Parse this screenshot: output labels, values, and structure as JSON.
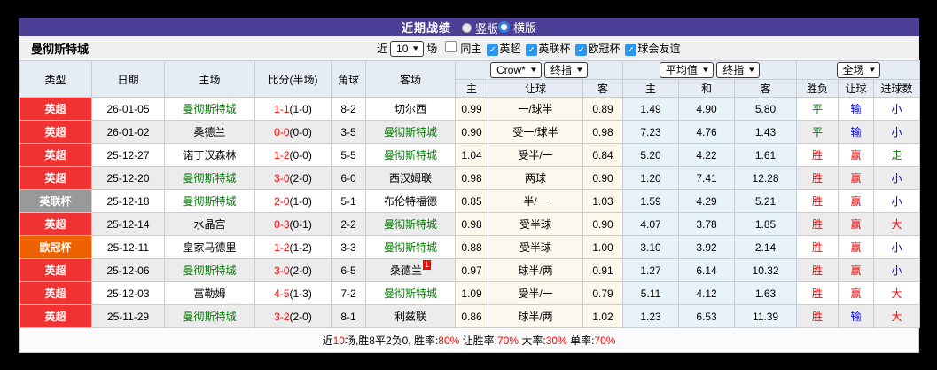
{
  "icons": {
    "select_caret": "▼",
    "checkbox_check": "✓"
  },
  "colors": {
    "title_bar": "#4c4096",
    "league_epl": "#ef3333",
    "league_eflcup": "#999999",
    "league_ucl": "#ee6101",
    "win_red": "#ff0000",
    "draw_green": "#008000",
    "lose_blue": "#0000f0"
  },
  "title_bar": {
    "title": "近期战绩",
    "radios": [
      {
        "label": "竖版",
        "checked": false
      },
      {
        "label": "横版",
        "checked": true
      }
    ]
  },
  "toolbar": {
    "team": "曼彻斯特城",
    "recent_prefix": "近",
    "recent_count": "10",
    "recent_suffix": "场",
    "filters": [
      {
        "label": "同主",
        "checked": false
      },
      {
        "label": "英超",
        "checked": true
      },
      {
        "label": "英联杯",
        "checked": true
      },
      {
        "label": "欧冠杯",
        "checked": true
      },
      {
        "label": "球会友谊",
        "checked": true
      }
    ]
  },
  "table": {
    "left_headers": [
      "类型",
      "日期",
      "主场",
      "比分(半场)",
      "角球",
      "客场"
    ],
    "selects": {
      "asian": [
        "Crow*",
        "终指"
      ],
      "europe": [
        "平均值",
        "终指"
      ],
      "result": [
        "全场"
      ]
    },
    "sub_headers": [
      "主",
      "让球",
      "客",
      "主",
      "和",
      "客",
      "胜负",
      "让球",
      "进球数"
    ],
    "rows": [
      {
        "type": "英超",
        "type_color": "#ef3333",
        "date": "26-01-05",
        "home": "曼彻斯特城",
        "home_highlight": true,
        "score": "1-1",
        "half": "(1-0)",
        "corner": "8-2",
        "away": "切尔西",
        "away_highlight": false,
        "away_card": "",
        "ah": [
          "0.99",
          "一/球半",
          "0.89"
        ],
        "eu": [
          "1.49",
          "4.90",
          "5.80"
        ],
        "result": {
          "text": "平",
          "color": "green"
        },
        "ah_result": {
          "text": "输",
          "color": "blue"
        },
        "goals": {
          "text": "小",
          "color": "blue"
        }
      },
      {
        "type": "英超",
        "type_color": "#ef3333",
        "date": "26-01-02",
        "home": "桑德兰",
        "home_highlight": false,
        "score": "0-0",
        "half": "(0-0)",
        "corner": "3-5",
        "away": "曼彻斯特城",
        "away_highlight": true,
        "away_card": "",
        "ah": [
          "0.90",
          "受一/球半",
          "0.98"
        ],
        "eu": [
          "7.23",
          "4.76",
          "1.43"
        ],
        "result": {
          "text": "平",
          "color": "green"
        },
        "ah_result": {
          "text": "输",
          "color": "blue"
        },
        "goals": {
          "text": "小",
          "color": "blue"
        }
      },
      {
        "type": "英超",
        "type_color": "#ef3333",
        "date": "25-12-27",
        "home": "诺丁汉森林",
        "home_highlight": false,
        "score": "1-2",
        "half": "(0-0)",
        "corner": "5-5",
        "away": "曼彻斯特城",
        "away_highlight": true,
        "away_card": "",
        "ah": [
          "1.04",
          "受半/一",
          "0.84"
        ],
        "eu": [
          "5.20",
          "4.22",
          "1.61"
        ],
        "result": {
          "text": "胜",
          "color": "red"
        },
        "ah_result": {
          "text": "赢",
          "color": "red"
        },
        "goals": {
          "text": "走",
          "color": "green"
        }
      },
      {
        "type": "英超",
        "type_color": "#ef3333",
        "date": "25-12-20",
        "home": "曼彻斯特城",
        "home_highlight": true,
        "score": "3-0",
        "half": "(2-0)",
        "corner": "6-0",
        "away": "西汉姆联",
        "away_highlight": false,
        "away_card": "",
        "ah": [
          "0.98",
          "两球",
          "0.90"
        ],
        "eu": [
          "1.20",
          "7.41",
          "12.28"
        ],
        "result": {
          "text": "胜",
          "color": "red"
        },
        "ah_result": {
          "text": "赢",
          "color": "red"
        },
        "goals": {
          "text": "小",
          "color": "blue"
        }
      },
      {
        "type": "英联杯",
        "type_color": "#999999",
        "date": "25-12-18",
        "home": "曼彻斯特城",
        "home_highlight": true,
        "score": "2-0",
        "half": "(1-0)",
        "corner": "5-1",
        "away": "布伦特福德",
        "away_highlight": false,
        "away_card": "",
        "ah": [
          "0.85",
          "半/一",
          "1.03"
        ],
        "eu": [
          "1.59",
          "4.29",
          "5.21"
        ],
        "result": {
          "text": "胜",
          "color": "red"
        },
        "ah_result": {
          "text": "赢",
          "color": "red"
        },
        "goals": {
          "text": "小",
          "color": "blue"
        }
      },
      {
        "type": "英超",
        "type_color": "#ef3333",
        "date": "25-12-14",
        "home": "水晶宫",
        "home_highlight": false,
        "score": "0-3",
        "half": "(0-1)",
        "corner": "2-2",
        "away": "曼彻斯特城",
        "away_highlight": true,
        "away_card": "",
        "ah": [
          "0.98",
          "受半球",
          "0.90"
        ],
        "eu": [
          "4.07",
          "3.78",
          "1.85"
        ],
        "result": {
          "text": "胜",
          "color": "red"
        },
        "ah_result": {
          "text": "赢",
          "color": "red"
        },
        "goals": {
          "text": "大",
          "color": "red"
        }
      },
      {
        "type": "欧冠杯",
        "type_color": "#ee6101",
        "date": "25-12-11",
        "home": "皇家马德里",
        "home_highlight": false,
        "score": "1-2",
        "half": "(1-2)",
        "corner": "3-3",
        "away": "曼彻斯特城",
        "away_highlight": true,
        "away_card": "",
        "ah": [
          "0.88",
          "受半球",
          "1.00"
        ],
        "eu": [
          "3.10",
          "3.92",
          "2.14"
        ],
        "result": {
          "text": "胜",
          "color": "red"
        },
        "ah_result": {
          "text": "赢",
          "color": "red"
        },
        "goals": {
          "text": "小",
          "color": "blue"
        }
      },
      {
        "type": "英超",
        "type_color": "#ef3333",
        "date": "25-12-06",
        "home": "曼彻斯特城",
        "home_highlight": true,
        "score": "3-0",
        "half": "(2-0)",
        "corner": "6-5",
        "away": "桑德兰",
        "away_highlight": false,
        "away_card": "1",
        "ah": [
          "0.97",
          "球半/两",
          "0.91"
        ],
        "eu": [
          "1.27",
          "6.14",
          "10.32"
        ],
        "result": {
          "text": "胜",
          "color": "red"
        },
        "ah_result": {
          "text": "赢",
          "color": "red"
        },
        "goals": {
          "text": "小",
          "color": "blue"
        }
      },
      {
        "type": "英超",
        "type_color": "#ef3333",
        "date": "25-12-03",
        "home": "富勒姆",
        "home_highlight": false,
        "score": "4-5",
        "half": "(1-3)",
        "corner": "7-2",
        "away": "曼彻斯特城",
        "away_highlight": true,
        "away_card": "",
        "ah": [
          "1.09",
          "受半/一",
          "0.79"
        ],
        "eu": [
          "5.11",
          "4.12",
          "1.63"
        ],
        "result": {
          "text": "胜",
          "color": "red"
        },
        "ah_result": {
          "text": "赢",
          "color": "red"
        },
        "goals": {
          "text": "大",
          "color": "red"
        }
      },
      {
        "type": "英超",
        "type_color": "#ef3333",
        "date": "25-11-29",
        "home": "曼彻斯特城",
        "home_highlight": true,
        "score": "3-2",
        "half": "(2-0)",
        "corner": "8-1",
        "away": "利兹联",
        "away_highlight": false,
        "away_card": "",
        "ah": [
          "0.86",
          "球半/两",
          "1.02"
        ],
        "eu": [
          "1.23",
          "6.53",
          "11.39"
        ],
        "result": {
          "text": "胜",
          "color": "red"
        },
        "ah_result": {
          "text": "输",
          "color": "blue"
        },
        "goals": {
          "text": "大",
          "color": "red"
        }
      }
    ]
  },
  "footer": {
    "segments": [
      {
        "text": "近",
        "red": false
      },
      {
        "text": "10",
        "red": true
      },
      {
        "text": "场,胜8平2负0, 胜率:",
        "red": false
      },
      {
        "text": "80%",
        "red": true
      },
      {
        "text": " 让胜率:",
        "red": false
      },
      {
        "text": "70%",
        "red": true
      },
      {
        "text": " 大率:",
        "red": false
      },
      {
        "text": "30%",
        "red": true
      },
      {
        "text": " 单率:",
        "red": false
      },
      {
        "text": "70%",
        "red": true
      }
    ]
  }
}
